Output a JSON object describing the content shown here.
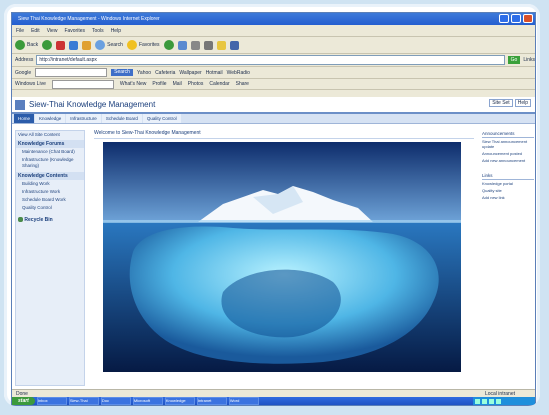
{
  "window": {
    "title": "Siew Thai Knowledge Management - Windows Internet Explorer"
  },
  "menubar": [
    "File",
    "Edit",
    "View",
    "Favorites",
    "Tools",
    "Help"
  ],
  "toolbar": {
    "back": "Back",
    "search": "Search",
    "favorites": "Favorites"
  },
  "address": {
    "label": "Address",
    "value": "http://intranet/default.aspx",
    "go": "Go",
    "links": "Links"
  },
  "googlebar": {
    "label": "Google",
    "search_btn": "Search",
    "items": [
      "Yahoo",
      "Cafeteria",
      "Wallpaper",
      "Hotmail",
      "WebRadio"
    ]
  },
  "linksbar": {
    "label": "Windows Live",
    "items": [
      "What's New",
      "Profile",
      "Mail",
      "Photos",
      "Calendar",
      "Share"
    ]
  },
  "site": {
    "title": "Siew-Thai Knowledge Management",
    "help_links": [
      "Site Set",
      "Help"
    ],
    "tabs": [
      "Home",
      "Knowledge",
      "Infrastructure",
      "Schedule Board",
      "Quality Control"
    ],
    "quicklaunch": {
      "view_all": "View All Site Content",
      "sections": [
        {
          "head": "Knowledge Forums",
          "items": [
            "Maintenance (Chat Board)",
            "Infrastructure (Knowledge Sharing)"
          ]
        },
        {
          "head": "Knowledge Contents",
          "items": [
            "Building Work",
            "Infrastructure Work",
            "Schedule Board Work",
            "Quality Control"
          ]
        }
      ],
      "recycle": "Recycle Bin"
    },
    "welcome": "Welcome to Siew-Thai Knowledge Management",
    "right": {
      "head1": "Announcements",
      "items1": [
        "Siew Thai announcement update",
        "Announcement posted",
        "Add new announcement"
      ],
      "head2": "Links",
      "items2": [
        "Knowledge portal",
        "Quality site",
        "Add new link"
      ]
    }
  },
  "status": {
    "left": "Done",
    "zone": "Local intranet"
  },
  "taskbar": {
    "start": "start",
    "tasks": [
      "Inbox",
      "Siew-Thai",
      "Doc",
      "Microsoft",
      "Knowledge",
      "Intranet",
      "Word"
    ]
  },
  "colors": {
    "accent": "#2b5caa",
    "titlebar": "#245ed0",
    "taskbar": "#1f52c4",
    "start": "#3c9a3c"
  }
}
